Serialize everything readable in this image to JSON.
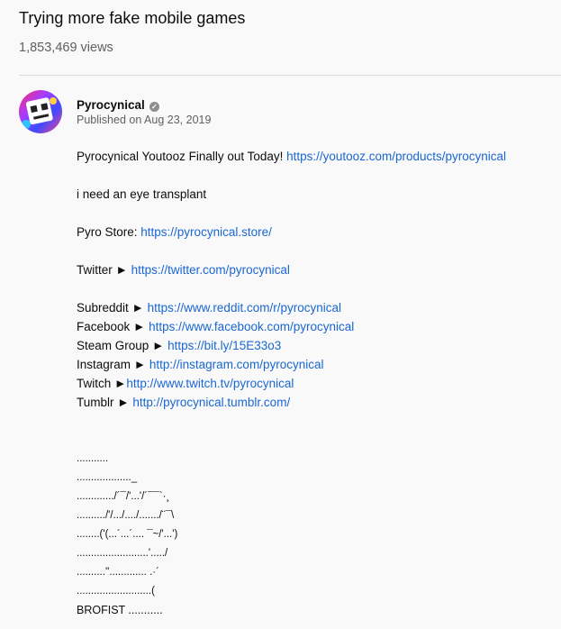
{
  "video": {
    "title": "Trying more fake mobile games",
    "views": "1,853,469 views"
  },
  "channel": {
    "name": "Pyrocynical",
    "verified_icon": "verified-check-icon",
    "published": "Published on Aug 23, 2019"
  },
  "description": {
    "youtooz_text": "Pyrocynical Youtooz Finally out Today! ",
    "youtooz_link": "https://youtooz.com/products/pyrocynical",
    "eye_line": "i need an eye transplant",
    "store_label": "Pyro Store: ",
    "store_link": "https://pyrocynical.store/",
    "twitter_label": "Twitter ► ",
    "twitter_link": "https://twitter.com/pyrocynical",
    "subreddit_label": "Subreddit ► ",
    "subreddit_link": "https://www.reddit.com/r/pyrocynical",
    "facebook_label": "Facebook ► ",
    "facebook_link": "https://www.facebook.com/pyrocynical",
    "steam_label": "Steam Group ► ",
    "steam_link": "https://bit.ly/15E33o3",
    "instagram_label": "Instagram ► ",
    "instagram_link": "http://instagram.com/pyrocynical",
    "twitch_label": "Twitch ►",
    "twitch_link": "http://www.twitch.tv/pyrocynical",
    "tumblr_label": "Tumblr ► ",
    "tumblr_link": "http://pyrocynical.tumblr.com/",
    "art": [
      "...........",
      "..................._",
      "............./´¯/'...'/´¯¯`·¸",
      "........../'/.../..../......./¨¯\\",
      "........('(...´...´.... ¯~/'...')",
      ".........................'...../",
      "..........''............. .·´",
      "..........................(",
      "BROFIST ..........."
    ]
  }
}
